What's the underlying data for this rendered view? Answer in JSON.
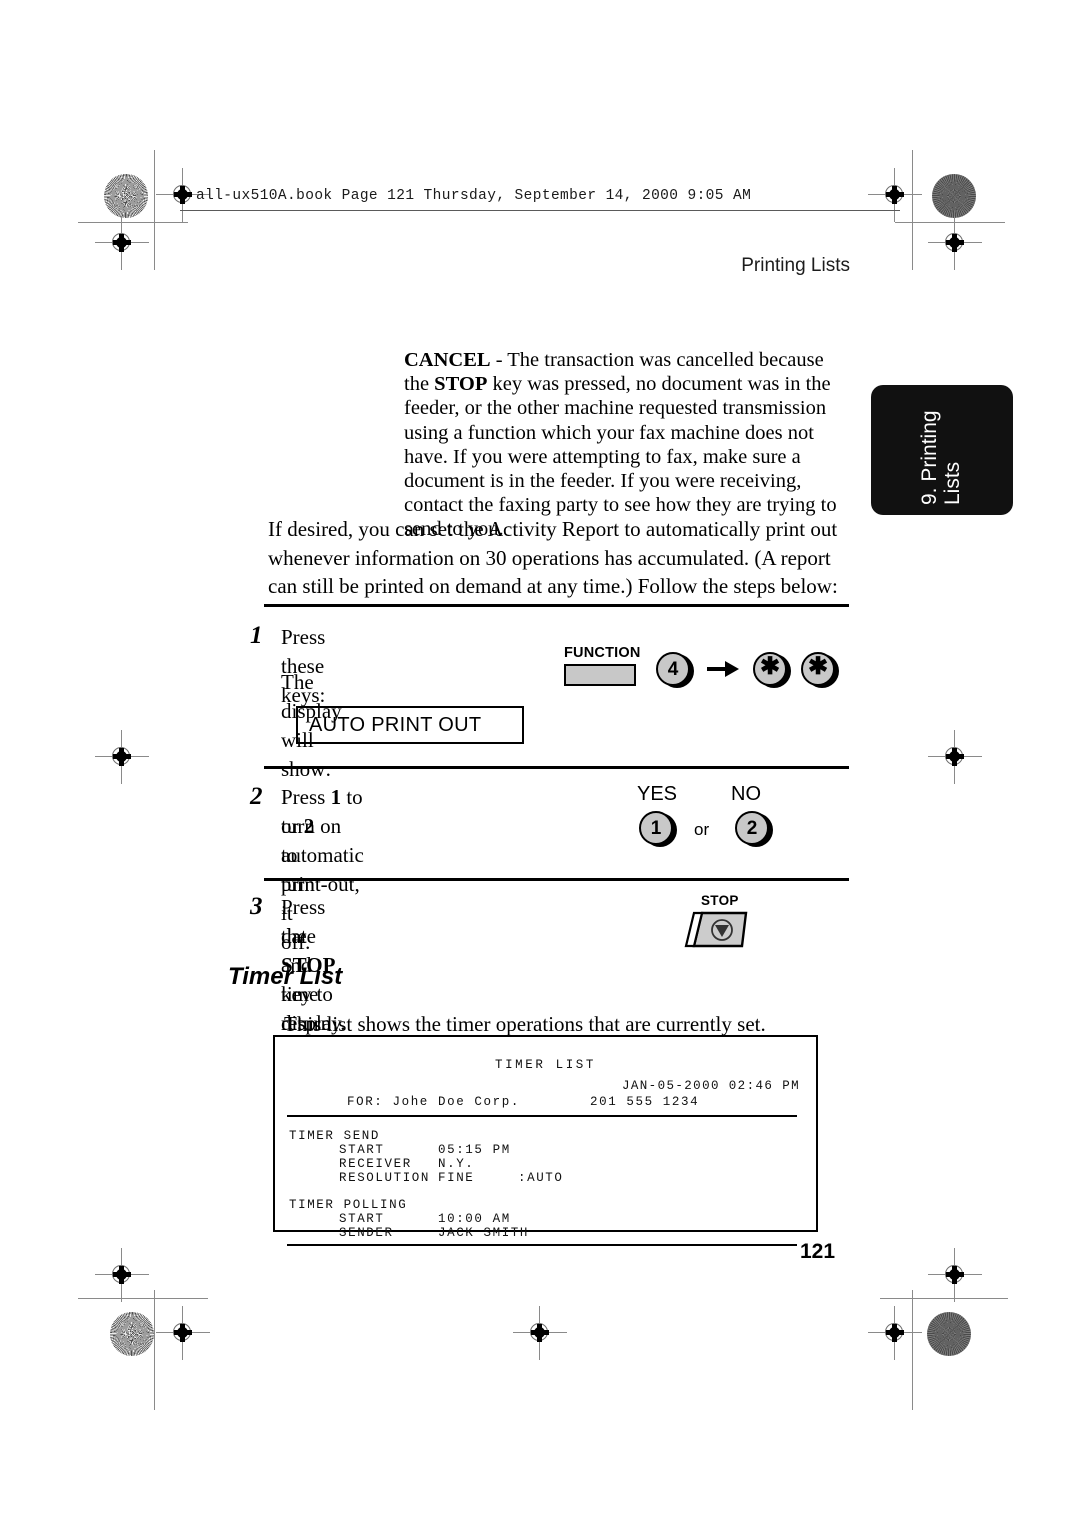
{
  "page": {
    "file_header": "all-ux510A.book  Page 121  Thursday, September 14, 2000  9:05 AM",
    "running_head": "Printing Lists",
    "folio": "121"
  },
  "thumb_tab": {
    "label": "9. Printing\nLists"
  },
  "note": {
    "term": "CANCEL",
    "text_1": " - The transaction was cancelled because the ",
    "term_2": "STOP",
    "text_2": " key was pressed, no document was in the feeder, or the other machine requested transmission using a function which your fax machine does not have. If you were attempting to fax, make sure a document is in the feeder. If you were receiving, contact the faxing party to see how they are trying to send to you."
  },
  "intro": {
    "paragraph": "If desired, you can set the Activity Report to automatically print out whenever information on 30 operations has accumulated. (A report can still be printed on demand at any time.) Follow the steps below:"
  },
  "steps": [
    {
      "number": "1",
      "line_1": "Press these keys:",
      "line_2": "The display will show:",
      "display_value": "AUTO PRINT OUT",
      "keys": {
        "function_label": "FUNCTION",
        "digit": "4",
        "arrow": "arrow-right-icon",
        "star_1": "✱",
        "star_2": "✱"
      }
    },
    {
      "number": "2",
      "text_a": "Press ",
      "bold_a": "1",
      "text_b": " to turn on automatic print-out,",
      "text_c": "or ",
      "bold_b": "2",
      "text_d": " to turn it off.",
      "yes_label": "YES",
      "no_label": "NO",
      "yes_key": "1",
      "no_key": "2",
      "or_word": "or"
    },
    {
      "number": "3",
      "text_a": "Press the ",
      "bold_a": "STOP",
      "text_b": " key to return to the",
      "text_c": "date and time display.",
      "stop_label": "STOP"
    }
  ],
  "section": {
    "heading": "Timer List",
    "paragraph": "This list shows the timer operations that are currently set."
  },
  "report": {
    "title": "TIMER LIST",
    "datetime": "JAN-05-2000 02:46 PM",
    "for_line": "FOR: Johe Doe Corp.",
    "phone": "201 555 1234",
    "sections": [
      {
        "heading": "TIMER SEND",
        "rows": [
          {
            "label": "START",
            "value": "05:15 PM",
            "extra": ""
          },
          {
            "label": "RECEIVER",
            "value": "N.Y.",
            "extra": ""
          },
          {
            "label": "RESOLUTION",
            "value": "FINE",
            "extra": ":AUTO"
          }
        ]
      },
      {
        "heading": "TIMER POLLING",
        "rows": [
          {
            "label": "START",
            "value": "10:00 AM",
            "extra": ""
          },
          {
            "label": "SENDER",
            "value": "JACK SMITH",
            "extra": ""
          }
        ]
      }
    ]
  }
}
